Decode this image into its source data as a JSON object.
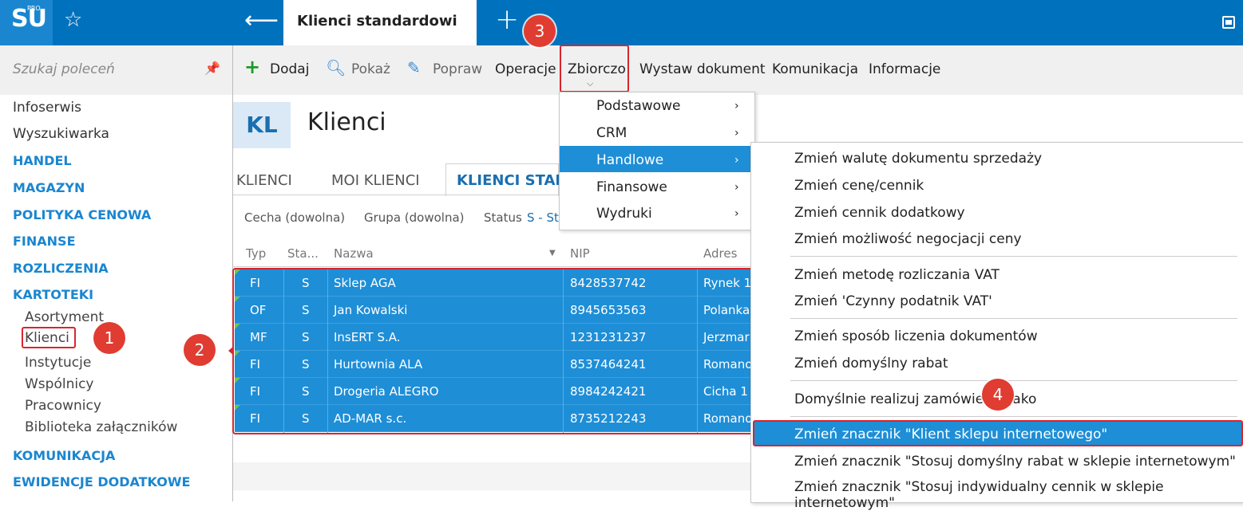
{
  "app": {
    "logo": "SU",
    "logo_sup": "PRO",
    "tab_title": "Klienci standardowi"
  },
  "sidebar": {
    "search_placeholder": "Szukaj poleceń",
    "links": [
      "Infoserwis",
      "Wyszukiwarka"
    ],
    "sections": [
      "HANDEL",
      "MAGAZYN",
      "POLITYKA CENOWA",
      "FINANSE",
      "ROZLICZENIA",
      "KARTOTEKI"
    ],
    "kartoteki_items": [
      "Asortyment",
      "Klienci",
      "Instytucje",
      "Wspólnicy",
      "Pracownicy",
      "Biblioteka załączników"
    ],
    "bottom_sections": [
      "KOMUNIKACJA",
      "EWIDENCJE DODATKOWE"
    ]
  },
  "toolbar": {
    "dodaj": "Dodaj",
    "pokaz": "Pokaż",
    "popraw": "Popraw",
    "operacje": "Operacje",
    "zbiorczo": "Zbiorczo",
    "wystaw": "Wystaw dokument",
    "komunikacja": "Komunikacja",
    "informacje": "Informacje"
  },
  "page": {
    "tile": "KL",
    "title": "Klienci",
    "tabs": [
      "KLIENCI",
      "MOI KLIENCI",
      "KLIENCI STAN"
    ],
    "filters": {
      "cecha": "Cecha (dowolna)",
      "grupa": "Grupa (dowolna)",
      "status_label": "Status",
      "status_value": "S - St"
    }
  },
  "table": {
    "headers": [
      "Typ",
      "Sta...",
      "Nazwa",
      "NIP",
      "Adres"
    ],
    "rows": [
      [
        "FI",
        "S",
        "Sklep AGA",
        "8428537742",
        "Rynek 1"
      ],
      [
        "OF",
        "S",
        "Jan Kowalski",
        "8945653563",
        "Polanka"
      ],
      [
        "MF",
        "S",
        "InsERT S.A.",
        "1231231237",
        "Jerzmar"
      ],
      [
        "FI",
        "S",
        "Hurtownia ALA",
        "8537464241",
        "Romano"
      ],
      [
        "FI",
        "S",
        "Drogeria ALEGRO",
        "8984242421",
        "Cicha 1"
      ],
      [
        "FI",
        "S",
        "AD-MAR s.c.",
        "8735212243",
        "Romano"
      ]
    ]
  },
  "menu1": [
    "Podstawowe",
    "CRM",
    "Handlowe",
    "Finansowe",
    "Wydruki"
  ],
  "menu2": [
    "Zmień walutę dokumentu sprzedaży",
    "Zmień cenę/cennik",
    "Zmień cennik dodatkowy",
    "Zmień możliwość negocjacji ceny",
    "Zmień metodę rozliczania VAT",
    "Zmień 'Czynny podatnik VAT'",
    "Zmień sposób liczenia dokumentów",
    "Zmień domyślny rabat",
    "Domyślnie realizuj zamówienie jako",
    "Zmień znacznik \"Klient sklepu internetowego\"",
    "Zmień znacznik \"Stosuj domyślny rabat w sklepie internetowym\"",
    "Zmień znacznik \"Stosuj indywidualny cennik w sklepie internetowym\""
  ],
  "badges": [
    "1",
    "2",
    "3",
    "4"
  ],
  "colors": {
    "brand": "#0071bc",
    "selection": "#1e8ed7",
    "highlight": "#d7262e"
  }
}
